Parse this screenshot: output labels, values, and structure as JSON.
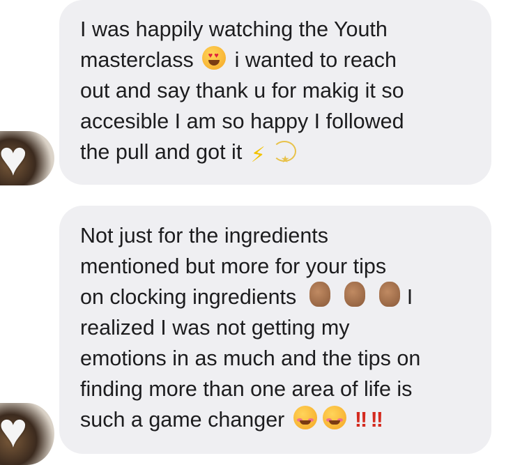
{
  "messages": [
    {
      "lines": [
        "I was happily watching the Youth",
        [
          "masterclass ",
          "i wanted to reach"
        ],
        "out and say thank u for makig it so",
        "accesible I am so happy I followed",
        "the pull and got it"
      ],
      "emoji": [
        "heart-eyes",
        "lightning",
        "dizzy"
      ]
    },
    {
      "lines": [
        "Not just for the ingredients",
        "mentioned but more for your tips",
        [
          "on clocking ingredients ",
          "I"
        ],
        "realized I was not getting my",
        "emotions in as much and the tips on",
        "finding more than one area of life is",
        [
          "such a game changer ",
          "!! !!"
        ]
      ],
      "emoji": [
        "pinched-fingers",
        "pinched-fingers",
        "pinched-fingers",
        "smiling-face-with-hearts",
        "smiling-face-with-hearts"
      ]
    }
  ],
  "avatar_icon": "white-heart-icon",
  "colors": {
    "bubble": "#efeff2",
    "text": "#1c1c1e",
    "exclaim": "#d42a1f"
  }
}
